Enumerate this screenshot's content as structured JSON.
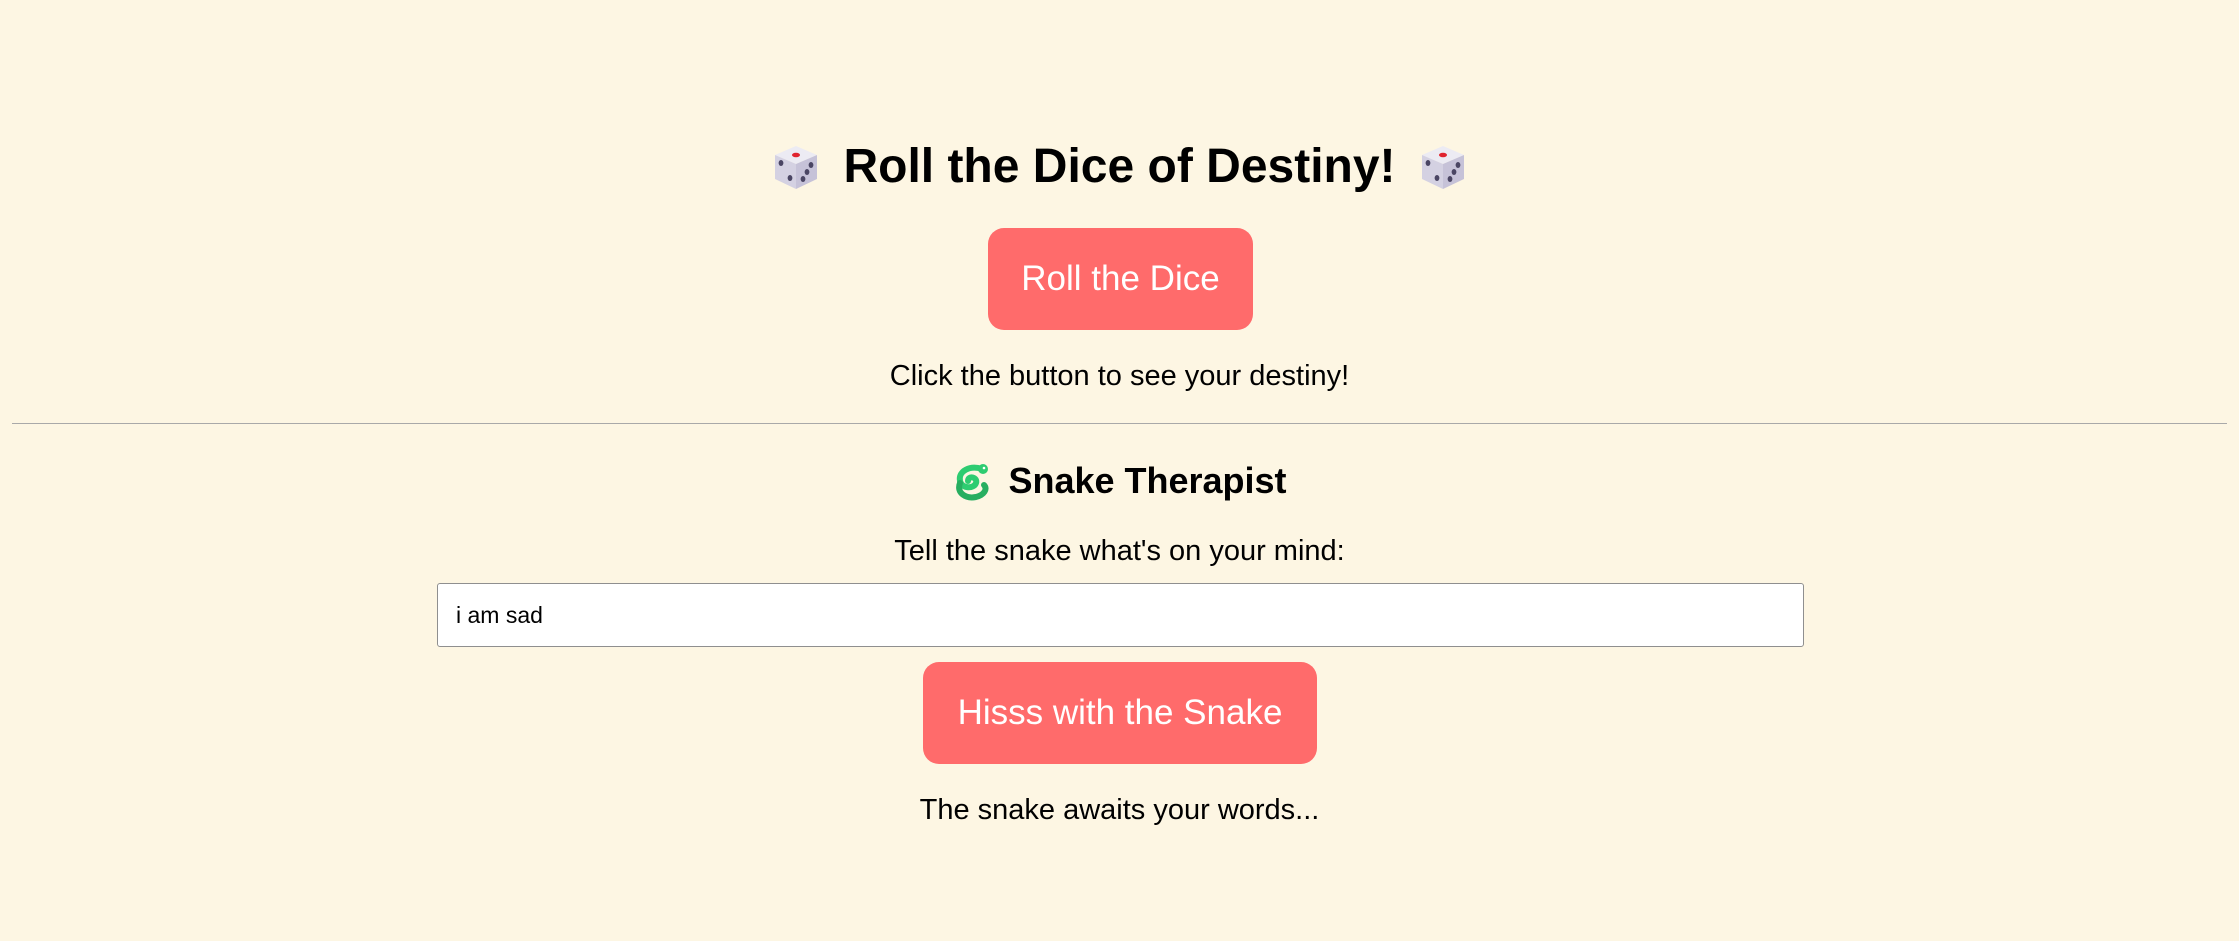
{
  "dice_section": {
    "title": "Roll the Dice of Destiny!",
    "left_icon": "die-icon",
    "right_icon": "die-icon",
    "roll_button_label": "Roll the Dice",
    "result_text": "Click the button to see your destiny!"
  },
  "snake_section": {
    "icon": "snake-icon",
    "title": "Snake Therapist",
    "prompt_label": "Tell the snake what's on your mind:",
    "input_value": "i am sad",
    "hiss_button_label": "Hisss with the Snake",
    "reply_text": "The snake awaits your words..."
  },
  "colors": {
    "background": "#fdf6e3",
    "button": "#ff6b6b",
    "button_text": "#ffffff",
    "snake_green": "#2ecc71"
  }
}
